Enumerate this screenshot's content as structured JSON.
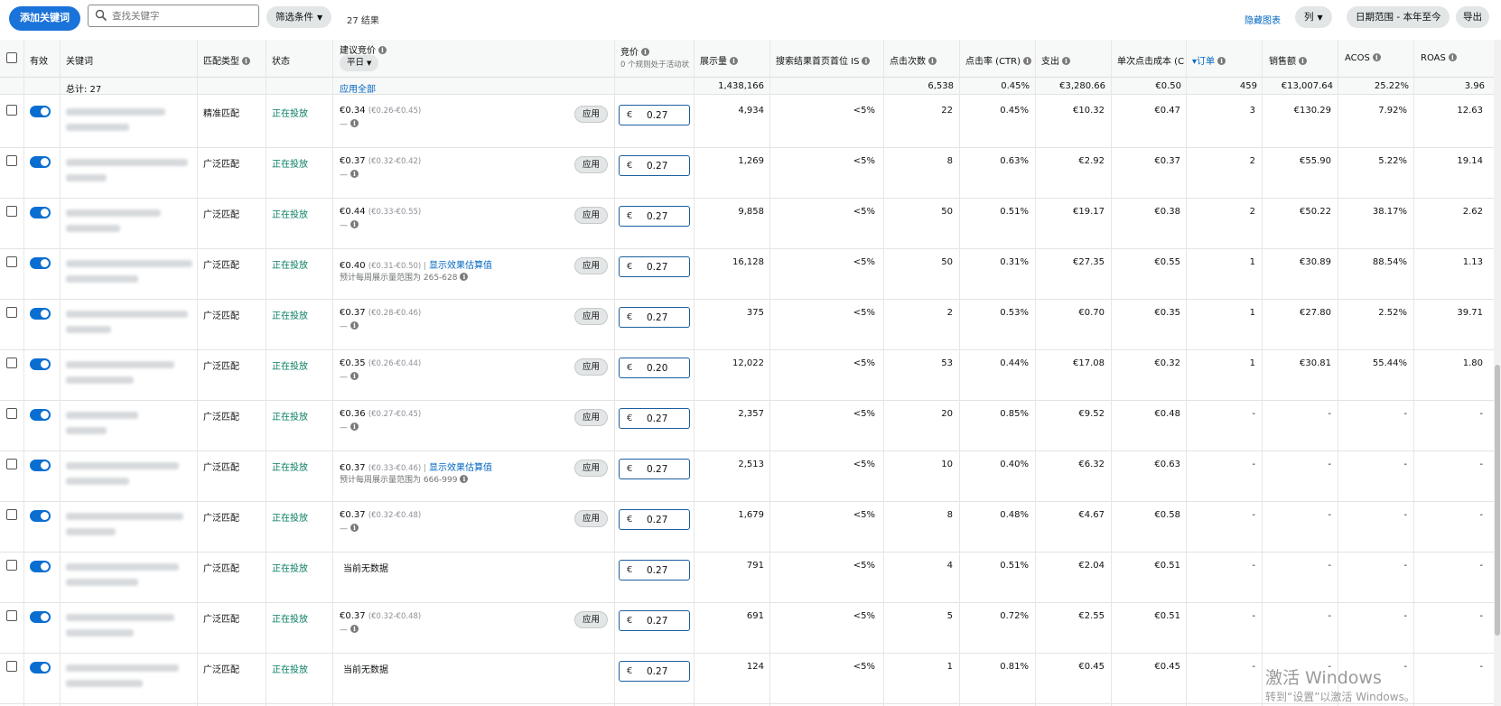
{
  "toolbar": {
    "add_keyword": "添加关键词",
    "search_placeholder": "查找关键字",
    "filter_label": "筛选条件",
    "results": "27 结果",
    "hide_chart": "隐藏图表",
    "columns": "列",
    "date_range": "日期范围 - 本年至今",
    "export": "导出"
  },
  "headers": {
    "active": "有效",
    "keyword": "关键词",
    "match_type": "匹配类型",
    "status": "状态",
    "suggested_bid": "建议竞价",
    "suggested_mode": "平日",
    "bid": "竞价",
    "bid_sub": "0 个规则处于活动状",
    "impressions": "展示量",
    "top_is": "搜索结果首页首位 IS",
    "clicks": "点击次数",
    "ctr": "点击率 (CTR)",
    "spend": "支出",
    "cpc": "单次点击成本 (CPC)",
    "orders": "订单",
    "sales": "销售额",
    "acos": "ACOS",
    "roas": "ROAS"
  },
  "summary": {
    "total": "总计: 27",
    "apply_all": "应用全部",
    "impressions": "1,438,166",
    "clicks": "6,538",
    "ctr": "0.45%",
    "spend": "€3,280.66",
    "cpc": "€0.50",
    "orders": "459",
    "sales": "€13,007.64",
    "acos": "25.22%",
    "roas": "3.96"
  },
  "labels": {
    "apply": "应用",
    "currency": "€",
    "show_estimate": "显示效果估算值",
    "no_data": "当前无数据"
  },
  "rows": [
    {
      "match": "精准匹配",
      "status": "正在投放",
      "sugg": "€0.34",
      "range": "(€0.26-€0.45)",
      "sub": "—",
      "est": false,
      "apply": true,
      "bid": "0.27",
      "impr": "4,934",
      "is": "<5%",
      "clicks": "22",
      "ctr": "0.45%",
      "spend": "€10.32",
      "cpc": "€0.47",
      "orders": "3",
      "sales": "€130.29",
      "acos": "7.92%",
      "roas": "12.63"
    },
    {
      "match": "广泛匹配",
      "status": "正在投放",
      "sugg": "€0.37",
      "range": "(€0.32-€0.42)",
      "sub": "—",
      "est": false,
      "apply": true,
      "bid": "0.27",
      "impr": "1,269",
      "is": "<5%",
      "clicks": "8",
      "ctr": "0.63%",
      "spend": "€2.92",
      "cpc": "€0.37",
      "orders": "2",
      "sales": "€55.90",
      "acos": "5.22%",
      "roas": "19.14"
    },
    {
      "match": "广泛匹配",
      "status": "正在投放",
      "sugg": "€0.44",
      "range": "(€0.33-€0.55)",
      "sub": "—",
      "est": false,
      "apply": true,
      "bid": "0.27",
      "impr": "9,858",
      "is": "<5%",
      "clicks": "50",
      "ctr": "0.51%",
      "spend": "€19.17",
      "cpc": "€0.38",
      "orders": "2",
      "sales": "€50.22",
      "acos": "38.17%",
      "roas": "2.62"
    },
    {
      "match": "广泛匹配",
      "status": "正在投放",
      "sugg": "€0.40",
      "range": "(€0.31-€0.50) |",
      "sub": "预计每周展示量范围为 265-628",
      "est": true,
      "apply": true,
      "bid": "0.27",
      "impr": "16,128",
      "is": "<5%",
      "clicks": "50",
      "ctr": "0.31%",
      "spend": "€27.35",
      "cpc": "€0.55",
      "orders": "1",
      "sales": "€30.89",
      "acos": "88.54%",
      "roas": "1.13"
    },
    {
      "match": "广泛匹配",
      "status": "正在投放",
      "sugg": "€0.37",
      "range": "(€0.28-€0.46)",
      "sub": "—",
      "est": false,
      "apply": true,
      "bid": "0.27",
      "impr": "375",
      "is": "<5%",
      "clicks": "2",
      "ctr": "0.53%",
      "spend": "€0.70",
      "cpc": "€0.35",
      "orders": "1",
      "sales": "€27.80",
      "acos": "2.52%",
      "roas": "39.71"
    },
    {
      "match": "广泛匹配",
      "status": "正在投放",
      "sugg": "€0.35",
      "range": "(€0.26-€0.44)",
      "sub": "—",
      "est": false,
      "apply": true,
      "bid": "0.20",
      "impr": "12,022",
      "is": "<5%",
      "clicks": "53",
      "ctr": "0.44%",
      "spend": "€17.08",
      "cpc": "€0.32",
      "orders": "1",
      "sales": "€30.81",
      "acos": "55.44%",
      "roas": "1.80"
    },
    {
      "match": "广泛匹配",
      "status": "正在投放",
      "sugg": "€0.36",
      "range": "(€0.27-€0.45)",
      "sub": "—",
      "est": false,
      "apply": true,
      "bid": "0.27",
      "impr": "2,357",
      "is": "<5%",
      "clicks": "20",
      "ctr": "0.85%",
      "spend": "€9.52",
      "cpc": "€0.48",
      "orders": "-",
      "sales": "-",
      "acos": "-",
      "roas": "-"
    },
    {
      "match": "广泛匹配",
      "status": "正在投放",
      "sugg": "€0.37",
      "range": "(€0.33-€0.46) |",
      "sub": "预计每周展示量范围为 666-999",
      "est": true,
      "apply": true,
      "bid": "0.27",
      "impr": "2,513",
      "is": "<5%",
      "clicks": "10",
      "ctr": "0.40%",
      "spend": "€6.32",
      "cpc": "€0.63",
      "orders": "-",
      "sales": "-",
      "acos": "-",
      "roas": "-"
    },
    {
      "match": "广泛匹配",
      "status": "正在投放",
      "sugg": "€0.37",
      "range": "(€0.32-€0.48)",
      "sub": "—",
      "est": false,
      "apply": true,
      "bid": "0.27",
      "impr": "1,679",
      "is": "<5%",
      "clicks": "8",
      "ctr": "0.48%",
      "spend": "€4.67",
      "cpc": "€0.58",
      "orders": "-",
      "sales": "-",
      "acos": "-",
      "roas": "-"
    },
    {
      "match": "广泛匹配",
      "status": "正在投放",
      "sugg": "",
      "range": "",
      "sub": "",
      "est": false,
      "apply": false,
      "nodata": true,
      "bid": "0.27",
      "impr": "791",
      "is": "<5%",
      "clicks": "4",
      "ctr": "0.51%",
      "spend": "€2.04",
      "cpc": "€0.51",
      "orders": "-",
      "sales": "-",
      "acos": "-",
      "roas": "-"
    },
    {
      "match": "广泛匹配",
      "status": "正在投放",
      "sugg": "€0.37",
      "range": "(€0.32-€0.48)",
      "sub": "—",
      "est": false,
      "apply": true,
      "bid": "0.27",
      "impr": "691",
      "is": "<5%",
      "clicks": "5",
      "ctr": "0.72%",
      "spend": "€2.55",
      "cpc": "€0.51",
      "orders": "-",
      "sales": "-",
      "acos": "-",
      "roas": "-"
    },
    {
      "match": "广泛匹配",
      "status": "正在投放",
      "sugg": "",
      "range": "",
      "sub": "",
      "est": false,
      "apply": false,
      "nodata": true,
      "bid": "0.27",
      "impr": "124",
      "is": "<5%",
      "clicks": "1",
      "ctr": "0.81%",
      "spend": "€0.45",
      "cpc": "€0.45",
      "orders": "-",
      "sales": "-",
      "acos": "-",
      "roas": "-"
    }
  ],
  "watermark": {
    "line1": "激活 Windows",
    "line2": "转到“设置”以激活 Windows。"
  },
  "colors": {
    "primary": "#1a73d9",
    "status_green": "#067d62",
    "link": "#0066c0"
  }
}
